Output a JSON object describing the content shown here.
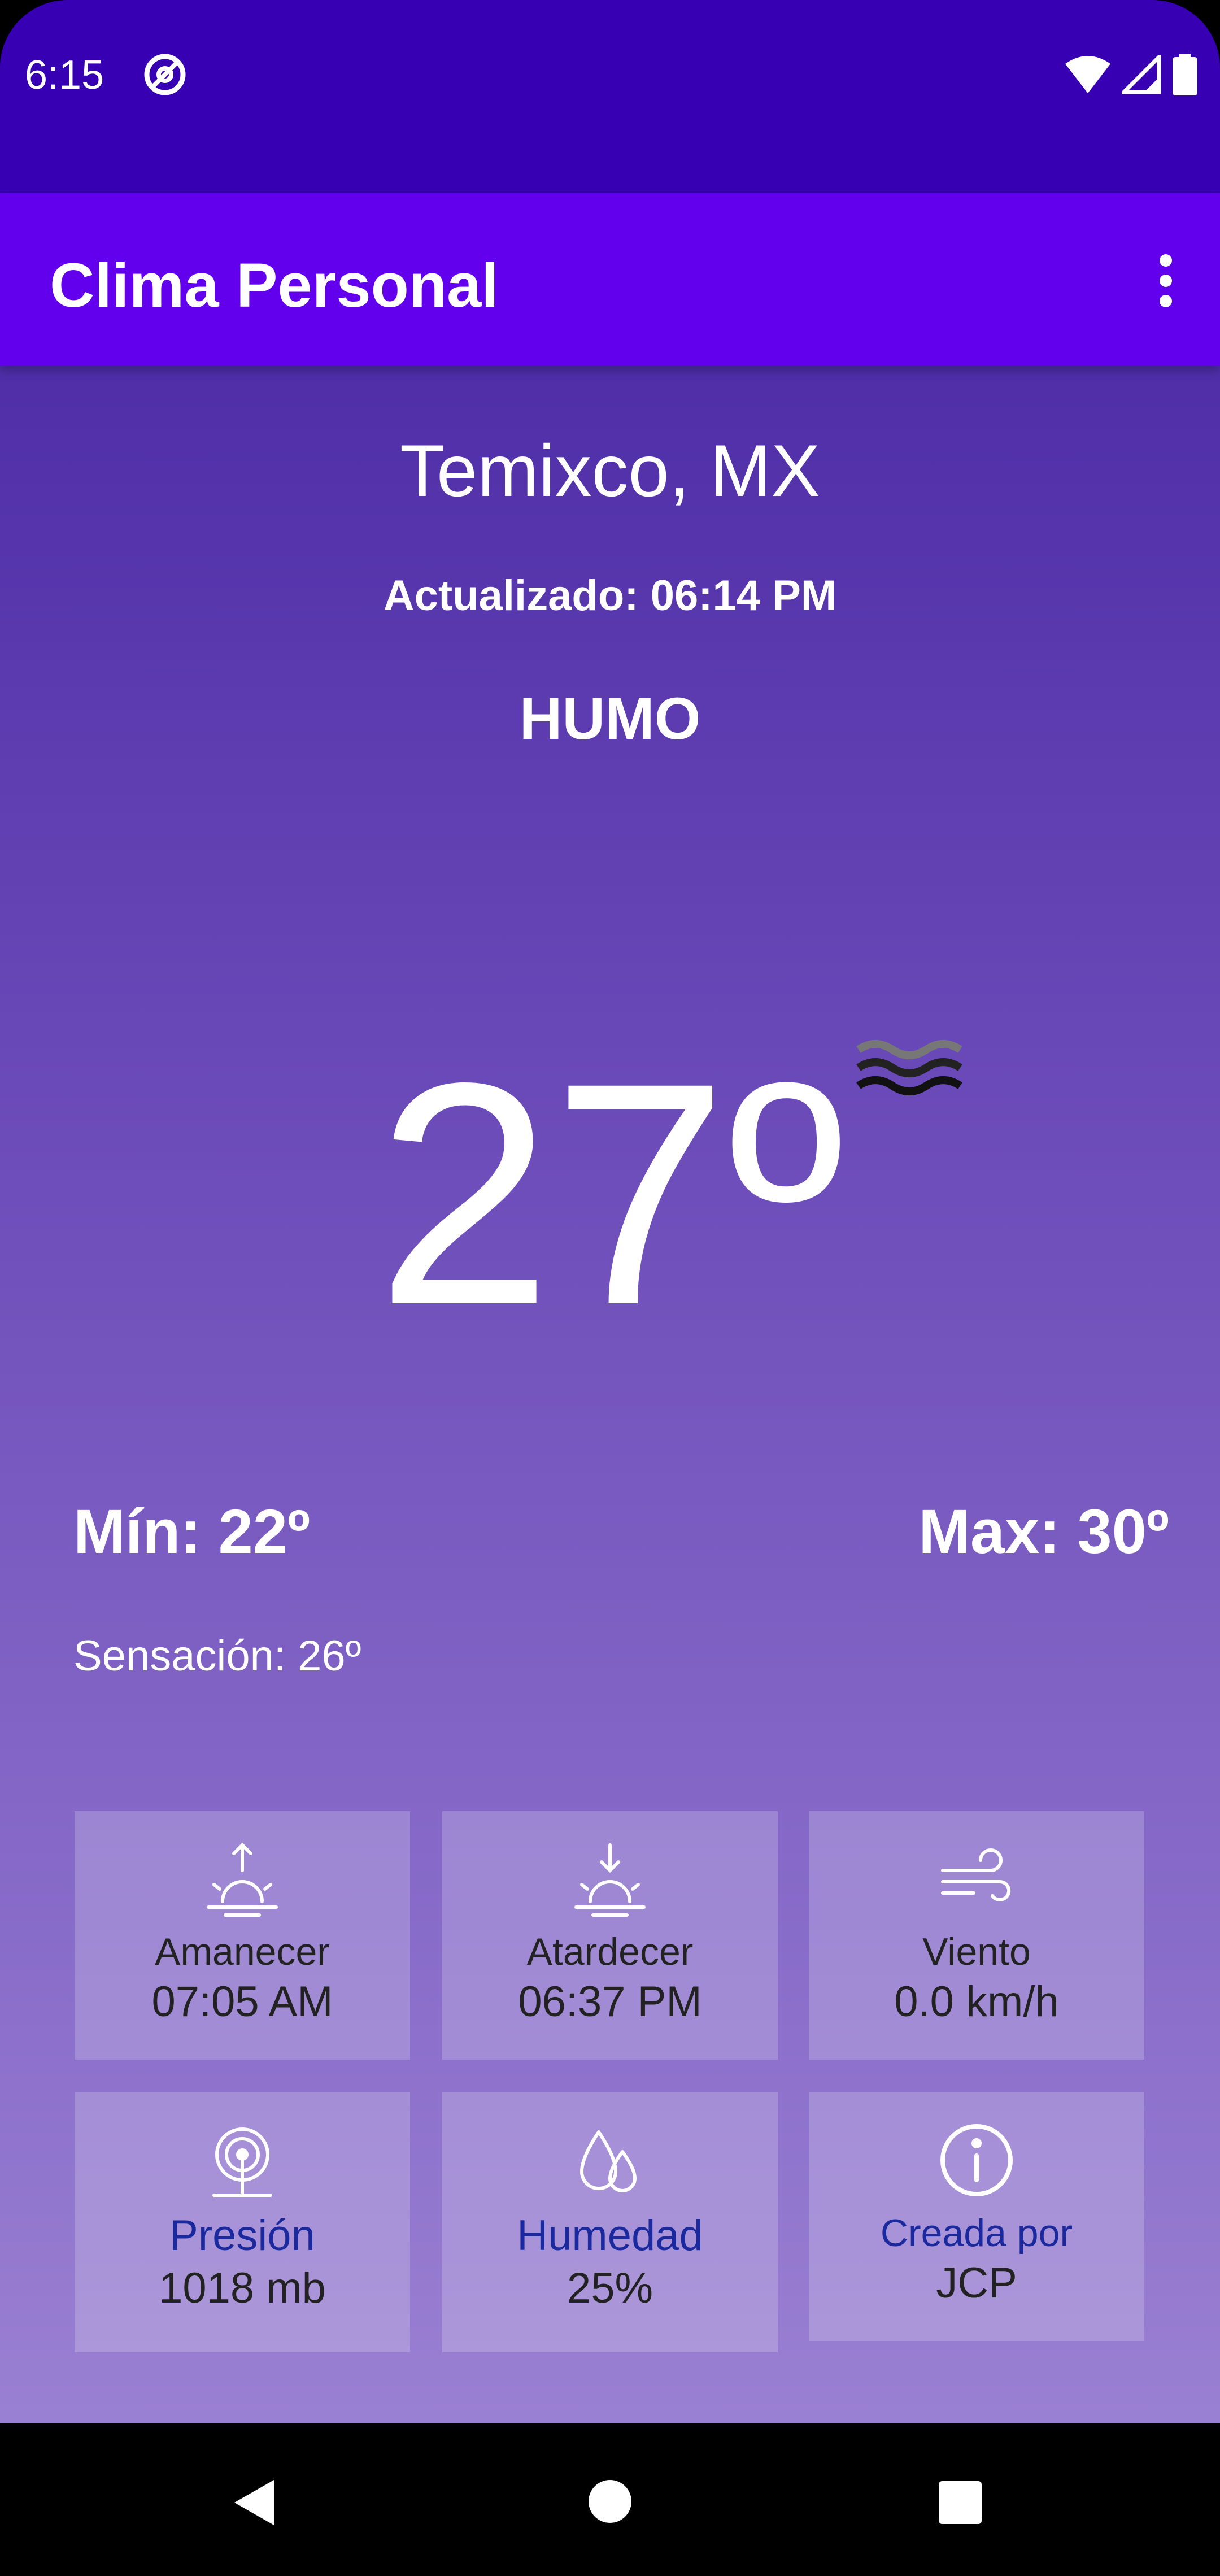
{
  "status": {
    "time": "6:15"
  },
  "app": {
    "title": "Clima Personal"
  },
  "weather": {
    "city": "Temixco, MX",
    "updated": "Actualizado: 06:14 PM",
    "description": "HUMO",
    "temperature": "27º",
    "min": "Mín: 22º",
    "max": "Max: 30º",
    "feels_like": "Sensación: 26º",
    "icon": "smoke-waves-icon"
  },
  "cards": [
    {
      "label": "Amanecer",
      "value": "07:05 AM",
      "icon": "sunrise-icon"
    },
    {
      "label": "Atardecer",
      "value": "06:37 PM",
      "icon": "sunset-icon"
    },
    {
      "label": "Viento",
      "value": "0.0 km/h",
      "icon": "wind-icon"
    },
    {
      "label": "Presión",
      "value": "1018 mb",
      "icon": "pressure-icon"
    },
    {
      "label": "Humedad",
      "value": "25%",
      "icon": "humidity-icon"
    },
    {
      "label": "Creada por",
      "value": "JCP",
      "icon": "info-icon"
    }
  ],
  "colors": {
    "statusbar": "#3700B3",
    "appbar": "#6200EE",
    "card_label_accent": "#1A2A9E"
  }
}
